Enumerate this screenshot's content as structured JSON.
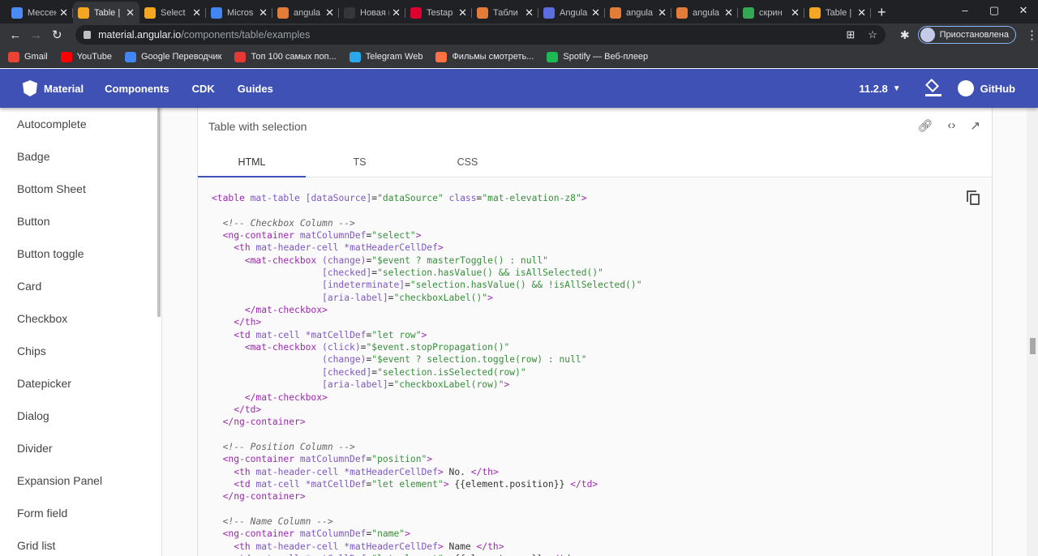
{
  "browser": {
    "tabs": [
      {
        "title": "Мессен",
        "color": "#4c8bf5",
        "active": false
      },
      {
        "title": "Table |",
        "color": "#f5a623",
        "active": true
      },
      {
        "title": "Select",
        "color": "#f5a623",
        "active": false
      },
      {
        "title": "Micros",
        "color": "#4285f4",
        "active": false
      },
      {
        "title": "angula",
        "color": "#e37b39",
        "active": false
      },
      {
        "title": "Новая вкл",
        "color": "#35363a",
        "active": false
      },
      {
        "title": "Testap",
        "color": "#dd0031",
        "active": false
      },
      {
        "title": "Табли",
        "color": "#e37b39",
        "active": false
      },
      {
        "title": "Angula",
        "color": "#5a6ee0",
        "active": false
      },
      {
        "title": "angula",
        "color": "#e37b39",
        "active": false
      },
      {
        "title": "angula",
        "color": "#e37b39",
        "active": false
      },
      {
        "title": "скрин",
        "color": "#34a853",
        "active": false
      },
      {
        "title": "Table |",
        "color": "#f5a623",
        "active": false
      }
    ],
    "url_host": "material.angular.io",
    "url_path": "/components/table/examples",
    "profile_label": "Приостановлена",
    "bookmarks": [
      {
        "label": "Gmail",
        "color": "#ea4335"
      },
      {
        "label": "YouTube",
        "color": "#ff0000"
      },
      {
        "label": "Google Переводчик",
        "color": "#4285f4"
      },
      {
        "label": "Топ 100 самых поп...",
        "color": "#e53935"
      },
      {
        "label": "Telegram Web",
        "color": "#29a9eb"
      },
      {
        "label": "Фильмы смотреть...",
        "color": "#ff7043"
      },
      {
        "label": "Spotify — Веб-плеер",
        "color": "#1db954"
      }
    ]
  },
  "header": {
    "brand": "Material",
    "links": [
      "Components",
      "CDK",
      "Guides"
    ],
    "version": "11.2.8",
    "github": "GitHub",
    "color": "#3f51b5"
  },
  "sidebar": {
    "items": [
      "Autocomplete",
      "Badge",
      "Bottom Sheet",
      "Button",
      "Button toggle",
      "Card",
      "Checkbox",
      "Chips",
      "Datepicker",
      "Dialog",
      "Divider",
      "Expansion Panel",
      "Form field",
      "Grid list"
    ]
  },
  "example": {
    "title": "Table with selection",
    "tabs": [
      "HTML",
      "TS",
      "CSS"
    ]
  }
}
